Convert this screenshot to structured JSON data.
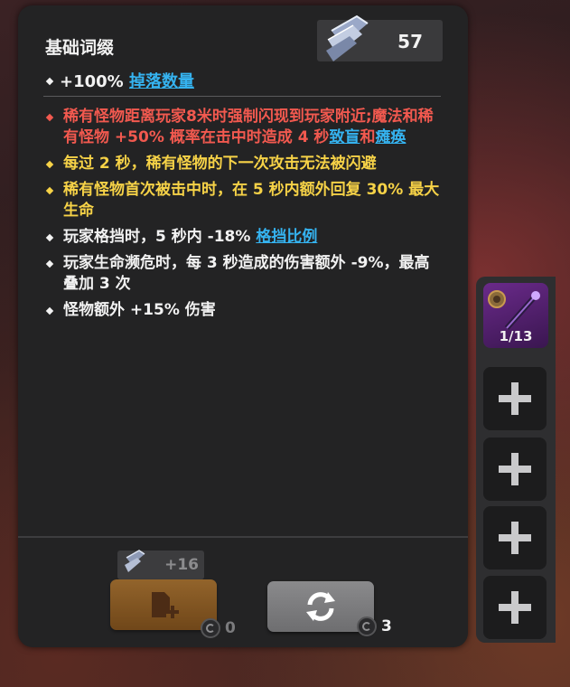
{
  "panel": {
    "title": "基础词缀",
    "shard_count": "57",
    "base_affix": {
      "prefix": "+100% ",
      "link": "掉落数量"
    },
    "affixes": [
      {
        "color": "red",
        "parts": [
          {
            "t": "稀有怪物距离玩家8米时强制闪现到玩家附近;"
          },
          {
            "t": "魔法和稀有怪物 +50% 概率在击中时造成 4 秒"
          },
          {
            "t": "致盲",
            "link": true
          },
          {
            "t": "和"
          },
          {
            "t": "瘫痪",
            "link": true
          }
        ]
      },
      {
        "color": "yellow",
        "parts": [
          {
            "t": "每过 2 秒，稀有怪物的下一次攻击无法被闪避"
          }
        ]
      },
      {
        "color": "yellow",
        "parts": [
          {
            "t": "稀有怪物首次被击中时，在 5 秒内额外回复 30% 最大生命"
          }
        ]
      },
      {
        "color": "white",
        "parts": [
          {
            "t": "玩家格挡时，5 秒内 -18% "
          },
          {
            "t": "格挡比例",
            "link": true
          }
        ]
      },
      {
        "color": "white",
        "parts": [
          {
            "t": "玩家生命濒危时，每 3 秒造成的伤害额外 -9%，最高叠加 3 次"
          }
        ]
      },
      {
        "color": "white",
        "parts": [
          {
            "t": "怪物额外 +15% 伤害"
          }
        ]
      }
    ]
  },
  "actions": {
    "add_affix": {
      "shard_bonus": "+16",
      "cost": "0",
      "icon": "add-document-icon"
    },
    "reroll": {
      "cost": "3",
      "icon": "refresh-icon"
    }
  },
  "sidebar": {
    "item": {
      "count": "1/13",
      "icon": "staff-item-icon"
    },
    "empty_slots": 4
  },
  "colors": {
    "red": "#f2594f",
    "yellow": "#f6d247",
    "white": "#f2f2f2",
    "link": "#35b3f0",
    "panel": "#232324"
  }
}
